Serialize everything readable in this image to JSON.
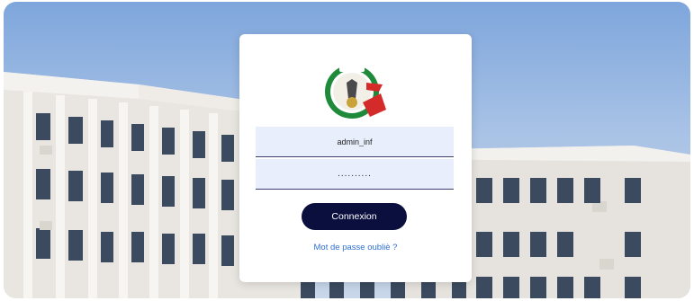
{
  "login": {
    "username_value": "admin_inf",
    "password_value": "..........",
    "submit_label": "Connexion",
    "forgot_link": "Mot de passe oubliè ?"
  },
  "colors": {
    "button_bg": "#0b0f3d",
    "link": "#2f6fd0",
    "field_bg": "#e8eefb"
  },
  "icons": [
    "university-logo"
  ]
}
